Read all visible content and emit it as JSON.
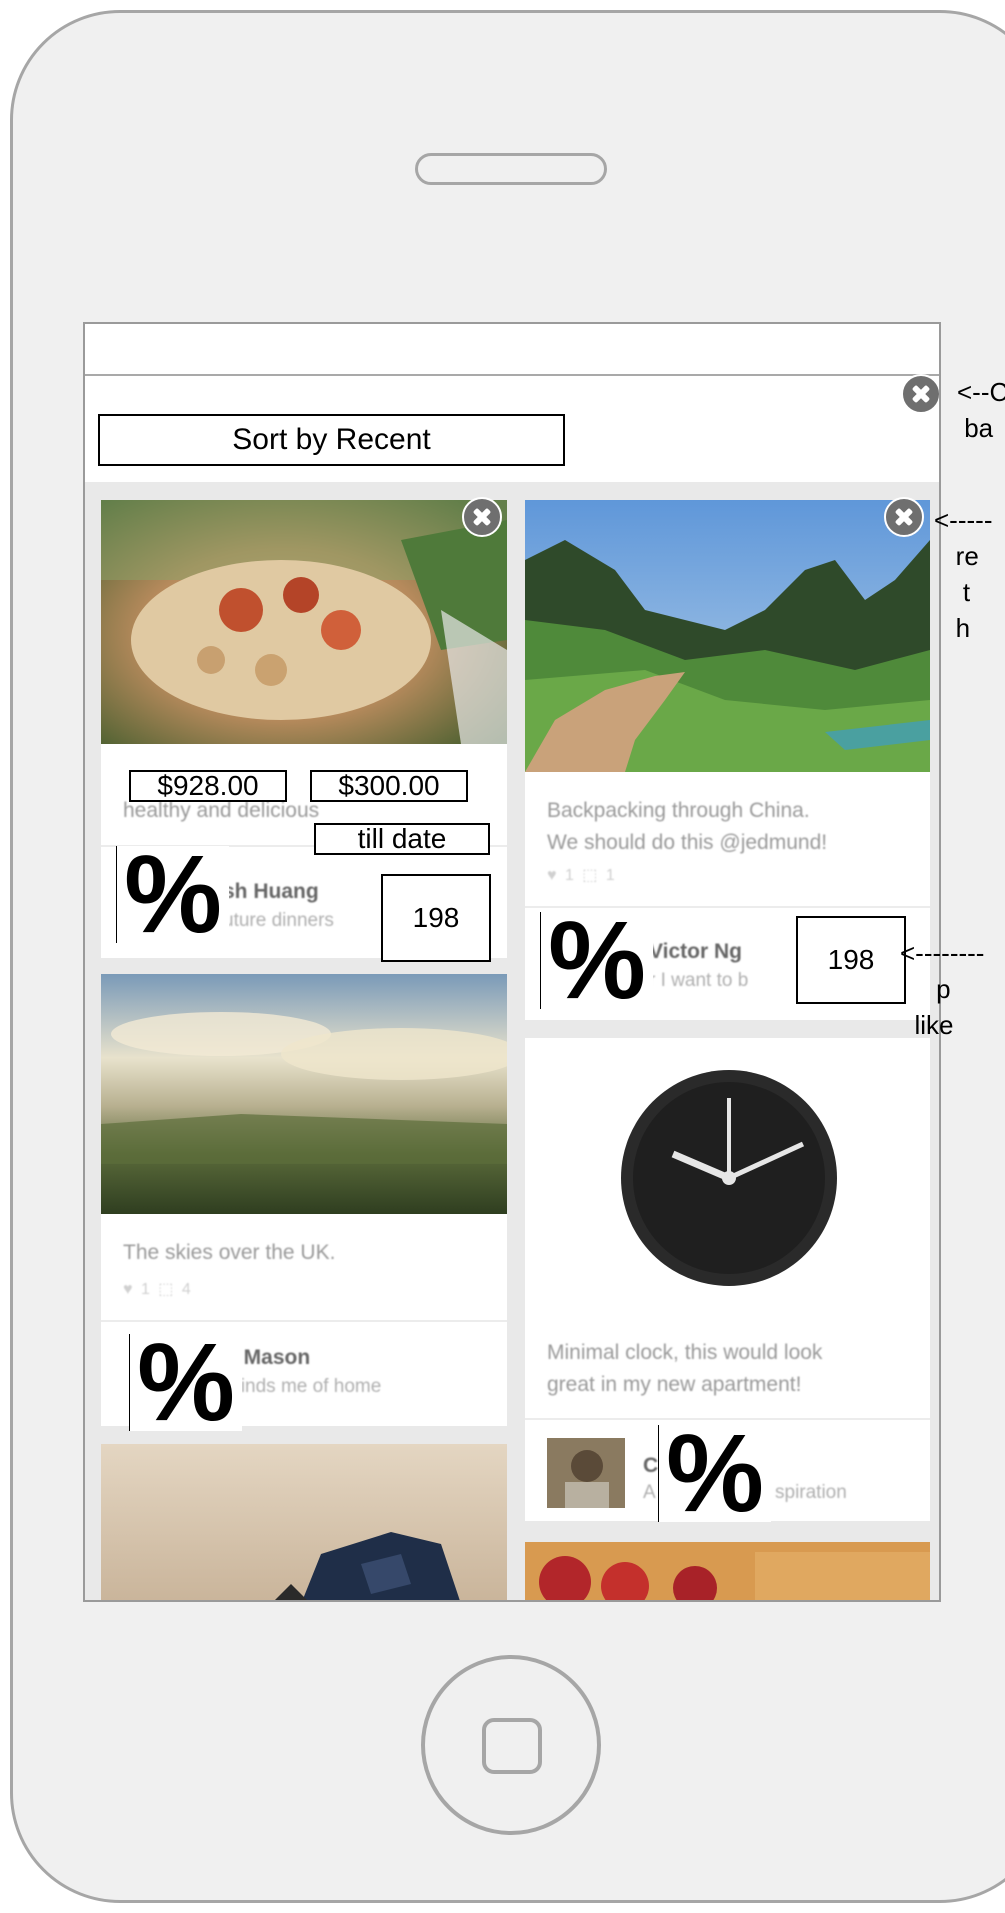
{
  "sort_label": "Sort by Recent",
  "cards": {
    "food": {
      "caption_line1": "",
      "caption_line2": "healthy and delicious",
      "author_name": "sh Huang",
      "author_sub": "uture dinners",
      "price_1": "$928.00",
      "price_2": "$300.00",
      "period_label": "till date",
      "likes_count": "198"
    },
    "china": {
      "caption_line1": "Backpacking through China.",
      "caption_line2": "We should do this @jedmund!",
      "stats": "♥ 1   ⬚ 1",
      "author_name": "Victor Ng",
      "author_sub": "r I want to b",
      "likes_count": "198"
    },
    "skies": {
      "caption_line1": "The skies over the UK.",
      "stats": "♥ 1   ⬚ 4",
      "author_name": "b Mason",
      "author_sub": "minds me of home"
    },
    "clock": {
      "caption_line1": "Minimal clock, this would look",
      "caption_line2": "great in my new apartment!",
      "author_initial": "C",
      "author_sub": "A",
      "author_sub_tail": "spiration"
    }
  },
  "percent_symbol": "%",
  "annotations": {
    "close_bar": "<--C\n ba",
    "remove_card": "<-----\n   re\n    t\n   h",
    "likes_box": "<--------\n     p\n  like"
  }
}
